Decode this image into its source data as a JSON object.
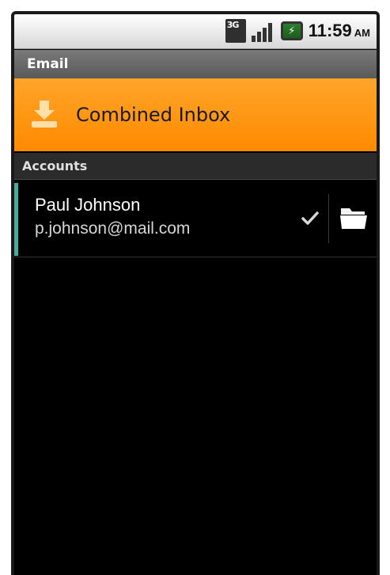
{
  "status_bar": {
    "network": "3G",
    "network_sub": "",
    "battery_glyph": "⚡",
    "time": "11:59",
    "ampm": "AM"
  },
  "app": {
    "title": "Email"
  },
  "combined_inbox": {
    "label": "Combined Inbox"
  },
  "accounts_section": {
    "header": "Accounts",
    "items": [
      {
        "name": "Paul Johnson",
        "email": "p.johnson@mail.com",
        "accent_color": "#4fa89a"
      }
    ]
  },
  "colors": {
    "accent_orange": "#ff8a00",
    "account_accent": "#4fa89a",
    "background": "#000000"
  },
  "icons": {
    "inbox": "inbox-download-icon",
    "check": "check-icon",
    "folder": "folder-icon"
  }
}
